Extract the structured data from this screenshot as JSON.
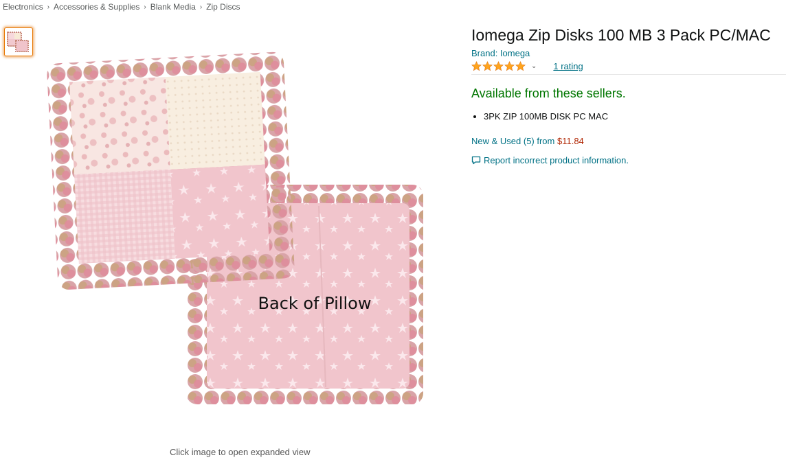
{
  "breadcrumb": {
    "items": [
      "Electronics",
      "Accessories & Supplies",
      "Blank Media",
      "Zip Discs"
    ],
    "separator": "›"
  },
  "product": {
    "title": "Iomega Zip Disks 100 MB 3 Pack PC/MAC",
    "brand": "Brand: Iomega",
    "rating_count": "1 rating",
    "stars": 5,
    "availability": "Available from these sellers.",
    "bullets": [
      "3PK ZIP 100MB DISK PC MAC"
    ],
    "new_used_label": "New & Used (5) from ",
    "new_used_price": "$11.84",
    "report_link": "Report incorrect product information."
  },
  "image": {
    "overlay_text": "Back of Pillow",
    "caption": "Click image to open expanded view"
  },
  "icons": {
    "star": "star-icon",
    "chevron": "chevron-down-icon",
    "report": "comment-icon"
  },
  "colors": {
    "link": "#007185",
    "star": "#ffa41c",
    "availability": "#007600",
    "price": "#b12704",
    "thumb_border": "#e77600"
  }
}
